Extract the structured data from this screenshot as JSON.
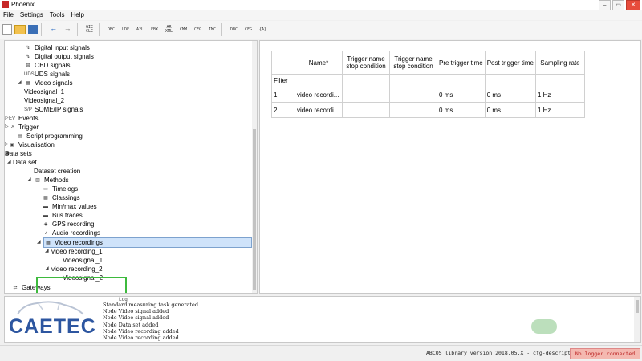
{
  "window": {
    "title": "Phoenix",
    "buttons": [
      "–",
      "▭",
      "✕"
    ]
  },
  "menu": [
    "File",
    "Settings",
    "Tools",
    "Help"
  ],
  "toolbar": {
    "tool_labels": [
      "GIC\nCLC",
      "DBC",
      "LDF",
      "A2L",
      "FBX",
      "AR\nXML",
      "CMM",
      "CFG",
      "IMC",
      "DBC",
      "CFG",
      "{A}"
    ]
  },
  "tree": [
    {
      "label": "Digital input signals",
      "icon": "↯"
    },
    {
      "label": "Digital output signals",
      "icon": "↯"
    },
    {
      "label": "OBD signals",
      "icon": "⊞"
    },
    {
      "label": "UDS signals",
      "icon": "UDS"
    },
    {
      "label": "Video signals",
      "icon": "▦",
      "expander": "◢"
    },
    {
      "label": "Videosignal_1",
      "icon": ""
    },
    {
      "label": "Videosignal_2",
      "icon": ""
    },
    {
      "label": "SOME/IP signals",
      "icon": "S/P"
    },
    {
      "label": "Events",
      "icon": "EV",
      "expander": "▷"
    },
    {
      "label": "Trigger",
      "icon": "↗",
      "expander": "▷"
    },
    {
      "label": "Script programming",
      "icon": "▤"
    },
    {
      "label": "Visualisation",
      "icon": "▣",
      "expander": "▷"
    },
    {
      "label": "Data sets",
      "icon": "",
      "expander": "◢"
    },
    {
      "label": "Data set",
      "icon": "",
      "expander": "◢"
    },
    {
      "label": "Dataset creation",
      "icon": ""
    },
    {
      "label": "Methods",
      "icon": "▥",
      "expander": "◢"
    },
    {
      "label": "Timelogs",
      "icon": "▭"
    },
    {
      "label": "Classings",
      "icon": "▦"
    },
    {
      "label": "Min/max values",
      "icon": "▬"
    },
    {
      "label": "Bus traces",
      "icon": "▬"
    },
    {
      "label": "GPS recording",
      "icon": "◈"
    },
    {
      "label": "Audio recordings",
      "icon": "♪"
    },
    {
      "label": "Video recordings",
      "icon": "▦",
      "expander": "◢"
    },
    {
      "label": "video recording_1",
      "icon": "",
      "expander": "◢"
    },
    {
      "label": "Videosignal_1",
      "icon": ""
    },
    {
      "label": "video recording_2",
      "icon": "",
      "expander": "◢"
    },
    {
      "label": "Videosignal_2",
      "icon": ""
    },
    {
      "label": "Gateways",
      "icon": "⇄"
    }
  ],
  "grid": {
    "columns": [
      "Name*",
      "Trigger name stop condition",
      "Trigger name stop condition",
      "Pre trigger time",
      "Post trigger time",
      "Sampling rate"
    ],
    "filter_label": "Filter",
    "rows": [
      {
        "index": "1",
        "cells": [
          "video recordi...",
          "",
          "",
          "0 ms",
          "0 ms",
          "1 Hz"
        ]
      },
      {
        "index": "2",
        "cells": [
          "video recordi...",
          "",
          "",
          "0 ms",
          "0 ms",
          "1 Hz"
        ]
      }
    ]
  },
  "log": {
    "title": "Log",
    "logo_text": "CAETEC",
    "lines": [
      "Standard measuring task generated",
      "Node Video signal added",
      "Node Video signal added",
      "Node Data set added",
      "Node Video recording added",
      "Node Video recording added"
    ]
  },
  "status": {
    "library": "ABCOS library version 2018.05.X - cfg-descriptor",
    "logger": "No logger connected"
  }
}
